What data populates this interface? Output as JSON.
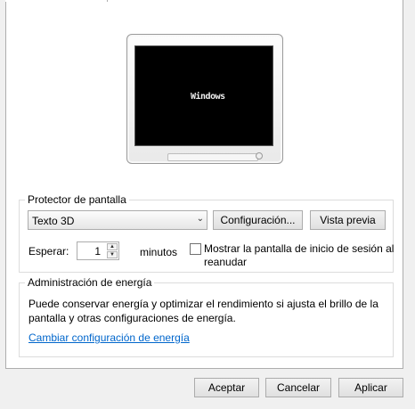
{
  "screensaver": {
    "group_title": "Protector de pantalla",
    "selected": "Texto 3D",
    "preview_text": "Windows",
    "settings_button": "Configuración...",
    "preview_button": "Vista previa",
    "wait_label": "Esperar:",
    "wait_value": "1",
    "minutes_label": "minutos",
    "resume_checkbox_label": "Mostrar la pantalla de inicio de sesión al reanudar",
    "resume_checked": false
  },
  "power": {
    "group_title": "Administración de energía",
    "description": "Puede conservar energía y optimizar el rendimiento si ajusta el brillo de la pantalla y otras configuraciones de energía.",
    "link": "Cambiar configuración de energía"
  },
  "footer": {
    "ok": "Aceptar",
    "cancel": "Cancelar",
    "apply": "Aplicar"
  },
  "colors": {
    "link": "#0066cc",
    "window_bg": "#f0f0f0",
    "screen_bg": "#000000"
  }
}
